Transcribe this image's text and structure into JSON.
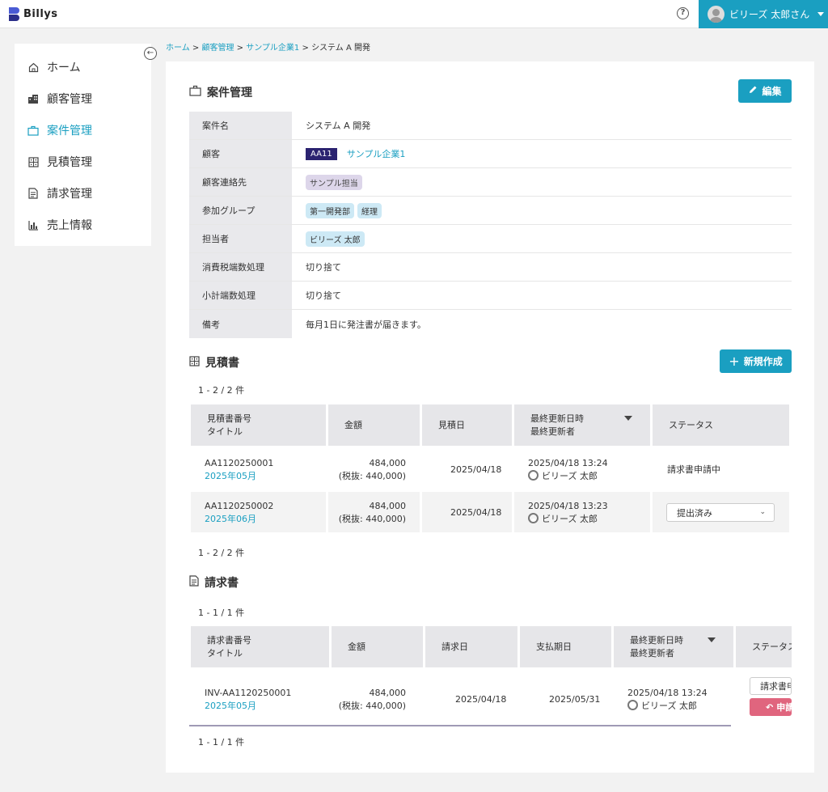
{
  "app": {
    "name": "Billys"
  },
  "user": {
    "name": "ビリーズ 太郎さん"
  },
  "sidebar": {
    "items": [
      {
        "label": "ホーム",
        "icon": "home-icon"
      },
      {
        "label": "顧客管理",
        "icon": "building-icon"
      },
      {
        "label": "案件管理",
        "icon": "briefcase-icon",
        "active": true
      },
      {
        "label": "見積管理",
        "icon": "calculator-icon"
      },
      {
        "label": "請求管理",
        "icon": "document-icon"
      },
      {
        "label": "売上情報",
        "icon": "bar-chart-icon"
      }
    ]
  },
  "breadcrumb": {
    "items": [
      "ホーム",
      "顧客管理",
      "サンプル企業1"
    ],
    "current": "システム A 開発",
    "separator": ">"
  },
  "project": {
    "title": "案件管理",
    "edit_label": "編集",
    "fields": {
      "name_label": "案件名",
      "name_value": "システム A 開発",
      "customer_label": "顧客",
      "customer_code": "AA11",
      "customer_name": "サンプル企業1",
      "contact_label": "顧客連絡先",
      "contact_value": "サンプル担当",
      "groups_label": "参加グループ",
      "group_1": "第一開発部",
      "group_2": "経理",
      "assignee_label": "担当者",
      "assignee_value": "ビリーズ 太郎",
      "tax_label": "消費税端数処理",
      "tax_value": "切り捨て",
      "subtotal_label": "小計端数処理",
      "subtotal_value": "切り捨て",
      "note_label": "備考",
      "note_value": "毎月1日に発注書が届きます。"
    }
  },
  "estimates": {
    "title": "見積書",
    "new_label": "新規作成",
    "count_top": "1 - 2 / 2 件",
    "count_bottom": "1 - 2 / 2 件",
    "headers": {
      "number": "見積書番号",
      "title": "タイトル",
      "amount": "金額",
      "date": "見積日",
      "updated": "最終更新日時",
      "updated_by": "最終更新者",
      "status": "ステータス"
    },
    "rows": [
      {
        "number": "AA1120250001",
        "title": "2025年05月",
        "amount": "484,000",
        "amount_ex": "(税抜: 440,000)",
        "date": "2025/04/18",
        "updated": "2025/04/18 13:24",
        "updated_by": "ビリーズ 太郎",
        "status": "請求書申請中"
      },
      {
        "number": "AA1120250002",
        "title": "2025年06月",
        "amount": "484,000",
        "amount_ex": "(税抜: 440,000)",
        "date": "2025/04/18",
        "updated": "2025/04/18 13:23",
        "updated_by": "ビリーズ 太郎",
        "status": "提出済み"
      }
    ]
  },
  "invoices": {
    "title": "請求書",
    "count_top": "1 - 1 / 1 件",
    "count_bottom": "1 - 1 / 1 件",
    "headers": {
      "number": "請求書番号",
      "title": "タイトル",
      "amount": "金額",
      "date": "請求日",
      "due": "支払期日",
      "updated": "最終更新日時",
      "updated_by": "最終更新者",
      "status": "ステータス"
    },
    "rows": [
      {
        "number": "INV-AA1120250001",
        "title": "2025年05月",
        "amount": "484,000",
        "amount_ex": "(税抜: 440,000)",
        "date": "2025/04/18",
        "due": "2025/05/31",
        "updated": "2025/04/18 13:24",
        "updated_by": "ビリーズ 太郎",
        "status": "請求書申請中",
        "action": "申請取消"
      }
    ]
  }
}
